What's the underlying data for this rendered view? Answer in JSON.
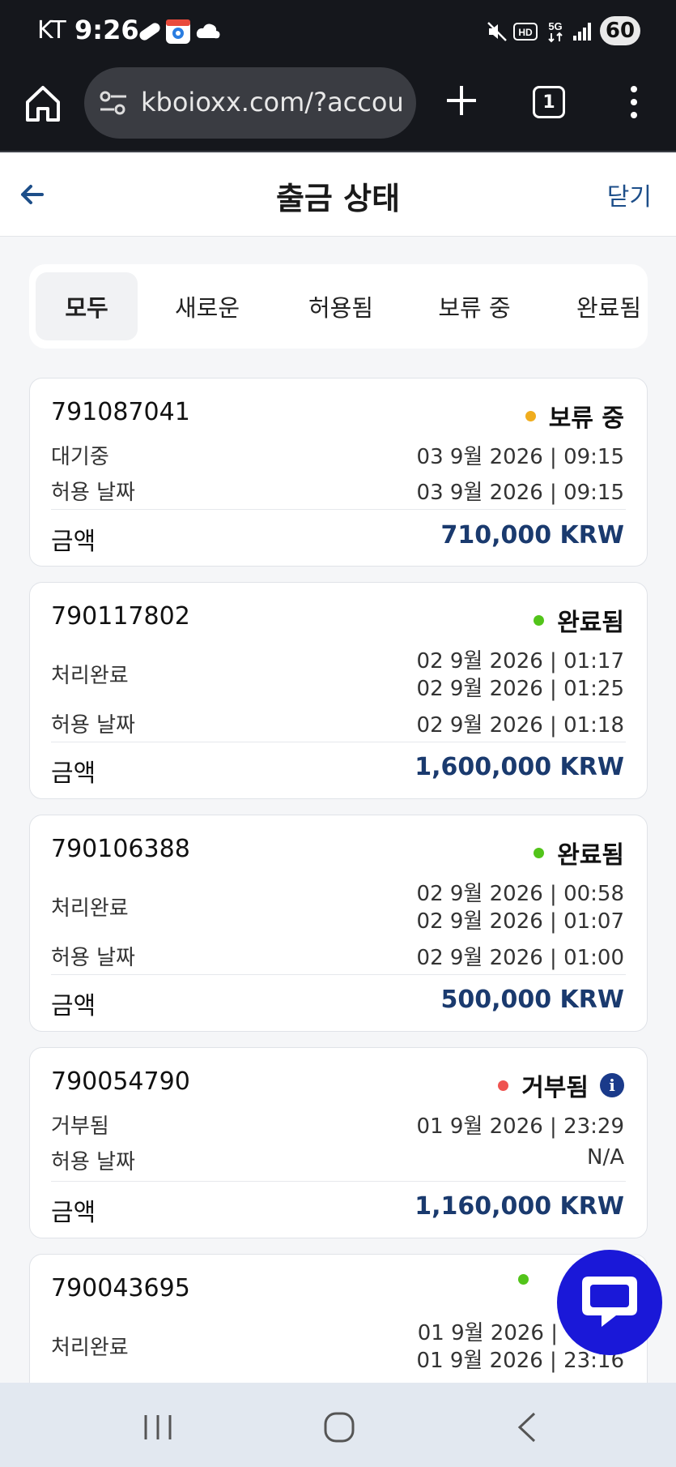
{
  "status_bar": {
    "carrier": "KT",
    "time": "9:26",
    "battery": "60"
  },
  "browser": {
    "url": "kboioxx.com/?accou",
    "tab_count": "1"
  },
  "header": {
    "title": "출금 상태",
    "close_label": "닫기"
  },
  "tabs": [
    {
      "label": "모두",
      "active": true
    },
    {
      "label": "새로운",
      "active": false
    },
    {
      "label": "허용됨",
      "active": false
    },
    {
      "label": "보류 중",
      "active": false
    },
    {
      "label": "완료됨",
      "active": false
    }
  ],
  "cards": [
    {
      "id": "791087041",
      "status": "보류 중",
      "status_color": "#f0ad1e",
      "detail_label": "대기중",
      "detail_value": "03 9월 2026 | 09:15",
      "allowed_label": "허용 날짜",
      "allowed_value": "03 9월 2026 | 09:15",
      "amount_label": "금액",
      "amount": "710,000 KRW"
    },
    {
      "id": "790117802",
      "status": "완료됨",
      "status_color": "#52c41a",
      "detail_label": "처리완료",
      "detail_value": "02 9월 2026 | 01:17",
      "detail_value2": "02 9월 2026 | 01:25",
      "allowed_label": "허용 날짜",
      "allowed_value": "02 9월 2026 | 01:18",
      "amount_label": "금액",
      "amount": "1,600,000 KRW"
    },
    {
      "id": "790106388",
      "status": "완료됨",
      "status_color": "#52c41a",
      "detail_label": "처리완료",
      "detail_value": "02 9월 2026 | 00:58",
      "detail_value2": "02 9월 2026 | 01:07",
      "allowed_label": "허용 날짜",
      "allowed_value": "02 9월 2026 | 01:00",
      "amount_label": "금액",
      "amount": "500,000 KRW"
    },
    {
      "id": "790054790",
      "status": "거부됨",
      "status_color": "#ef5350",
      "info_icon": "i",
      "detail_label": "거부됨",
      "detail_value": "01 9월 2026 | 23:29",
      "allowed_label": "허용 날짜",
      "allowed_value": "N/A",
      "amount_label": "금액",
      "amount": "1,160,000 KRW"
    },
    {
      "id": "790043695",
      "status_color": "#52c41a",
      "detail_label": "처리완료",
      "detail_value": "01 9월 2026 |",
      "detail_value2": "01 9월 2026 | 23:16"
    }
  ],
  "icons": {
    "home": "home-icon",
    "tune": "tune-icon",
    "plus": "plus-icon",
    "menu": "more-vert-icon",
    "back": "arrow-left-icon",
    "chat": "chat-bubble-icon",
    "recents": "recents-icon",
    "nav_home": "nav-home-icon",
    "nav_back": "nav-back-icon"
  },
  "colors": {
    "accent": "#1d4e89",
    "amount": "#1a3a6e",
    "chat_fab": "#1a18d8"
  }
}
